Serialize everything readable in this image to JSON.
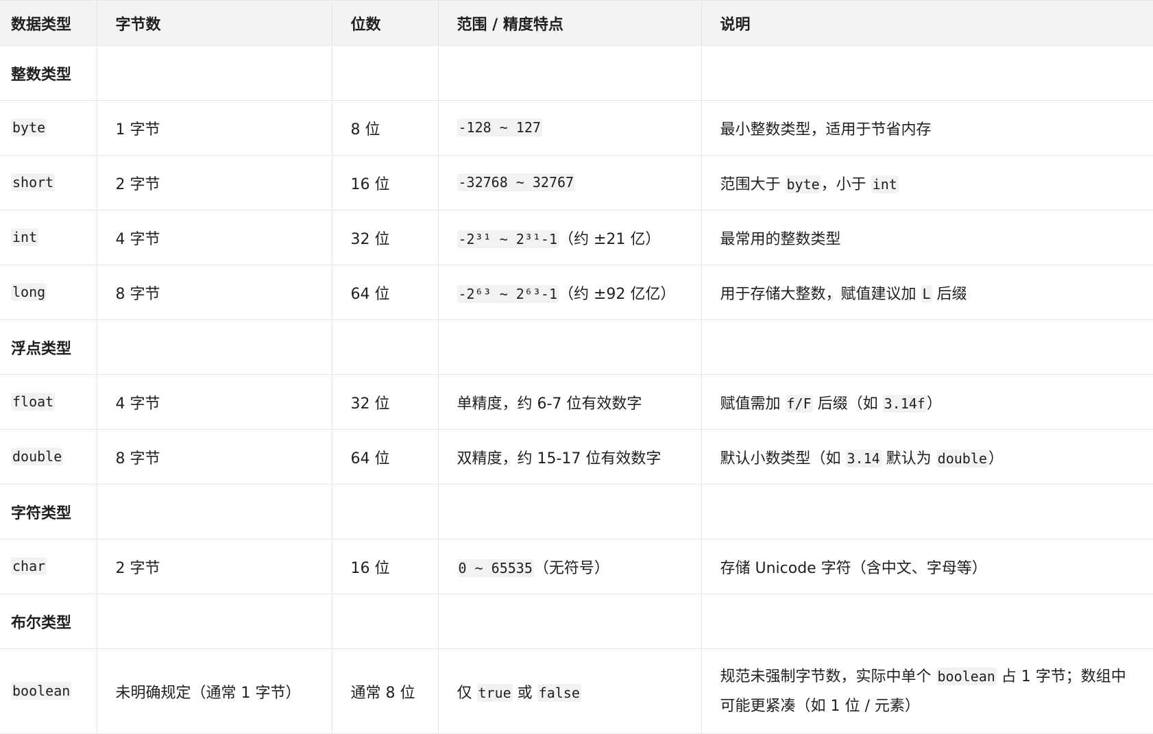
{
  "headers": [
    "数据类型",
    "字节数",
    "位数",
    "范围 / 精度特点",
    "说明"
  ],
  "sections": {
    "integer": "整数类型",
    "float": "浮点类型",
    "char": "字符类型",
    "boolean": "布尔类型"
  },
  "rows": {
    "byte": {
      "type": "byte",
      "bytes": "1 字节",
      "bits": "8 位",
      "range_code": "-128 ~ 127",
      "desc": "最小整数类型，适用于节省内存"
    },
    "short": {
      "type": "short",
      "bytes": "2 字节",
      "bits": "16 位",
      "range_code": "-32768 ~ 32767",
      "desc_pre": "范围大于 ",
      "desc_code1": "byte",
      "desc_mid": "，小于 ",
      "desc_code2": "int"
    },
    "int": {
      "type": "int",
      "bytes": "4 字节",
      "bits": "32 位",
      "range_code": "-2³¹ ~ 2³¹-1",
      "range_post": "（约 ±21 亿）",
      "desc": "最常用的整数类型"
    },
    "long": {
      "type": "long",
      "bytes": "8 字节",
      "bits": "64 位",
      "range_code": "-2⁶³ ~ 2⁶³-1",
      "range_post": "（约 ±92 亿亿）",
      "desc_pre": "用于存储大整数，赋值建议加 ",
      "desc_code1": "L",
      "desc_post": " 后缀"
    },
    "float": {
      "type": "float",
      "bytes": "4 字节",
      "bits": "32 位",
      "range": "单精度，约 6-7 位有效数字",
      "desc_pre": "赋值需加 ",
      "desc_code1": "f/F",
      "desc_mid": " 后缀（如 ",
      "desc_code2": "3.14f",
      "desc_post": "）"
    },
    "double": {
      "type": "double",
      "bytes": "8 字节",
      "bits": "64 位",
      "range": "双精度，约 15-17 位有效数字",
      "desc_pre": "默认小数类型（如 ",
      "desc_code1": "3.14",
      "desc_mid": " 默认为 ",
      "desc_code2": "double",
      "desc_post": "）"
    },
    "char": {
      "type": "char",
      "bytes": "2 字节",
      "bits": "16 位",
      "range_code": "0 ~ 65535",
      "range_post": "（无符号）",
      "desc": "存储 Unicode 字符（含中文、字母等）"
    },
    "boolean": {
      "type": "boolean",
      "bytes": "未明确规定（通常 1 字节）",
      "bits": "通常 8 位",
      "range_pre": "仅 ",
      "range_code1": "true",
      "range_mid": " 或 ",
      "range_code2": "false",
      "desc_pre": "规范未强制字节数，实际中单个 ",
      "desc_code1": "boolean",
      "desc_post": " 占 1 字节；数组中可能更紧凑（如 1 位 / 元素）"
    }
  }
}
